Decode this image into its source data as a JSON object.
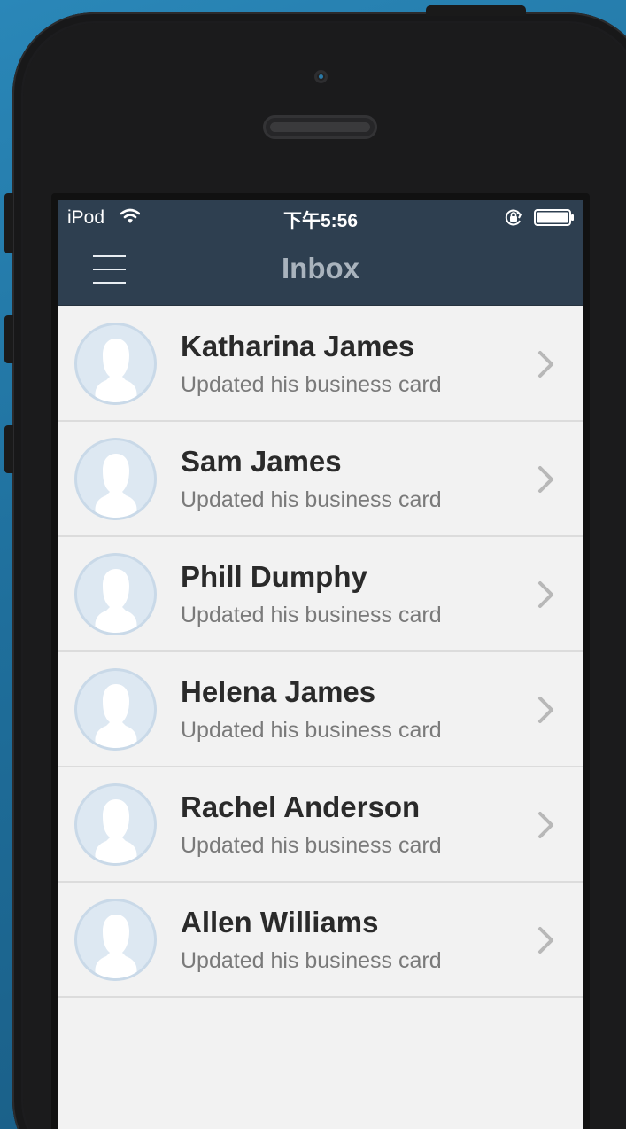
{
  "status_bar": {
    "carrier": "iPod",
    "time": "下午5:56",
    "icons": [
      "wifi-icon",
      "rotation-lock-icon",
      "battery-icon"
    ]
  },
  "nav_bar": {
    "title": "Inbox",
    "menu_icon": "hamburger-menu-icon",
    "background_color": "#2e3f50"
  },
  "inbox": {
    "items": [
      {
        "name": "Katharina James",
        "subtitle": "Updated his business card"
      },
      {
        "name": "Sam James",
        "subtitle": "Updated his business card"
      },
      {
        "name": "Phill Dumphy",
        "subtitle": "Updated his business card"
      },
      {
        "name": "Helena James",
        "subtitle": "Updated his business card"
      },
      {
        "name": "Rachel Anderson",
        "subtitle": "Updated his business card"
      },
      {
        "name": "Allen Williams",
        "subtitle": "Updated his business card"
      }
    ]
  },
  "colors": {
    "list_background": "#f2f2f2",
    "avatar_fill": "#dde8f2",
    "name_text": "#2a2a2a",
    "subtitle_text": "#7a7a7a"
  }
}
